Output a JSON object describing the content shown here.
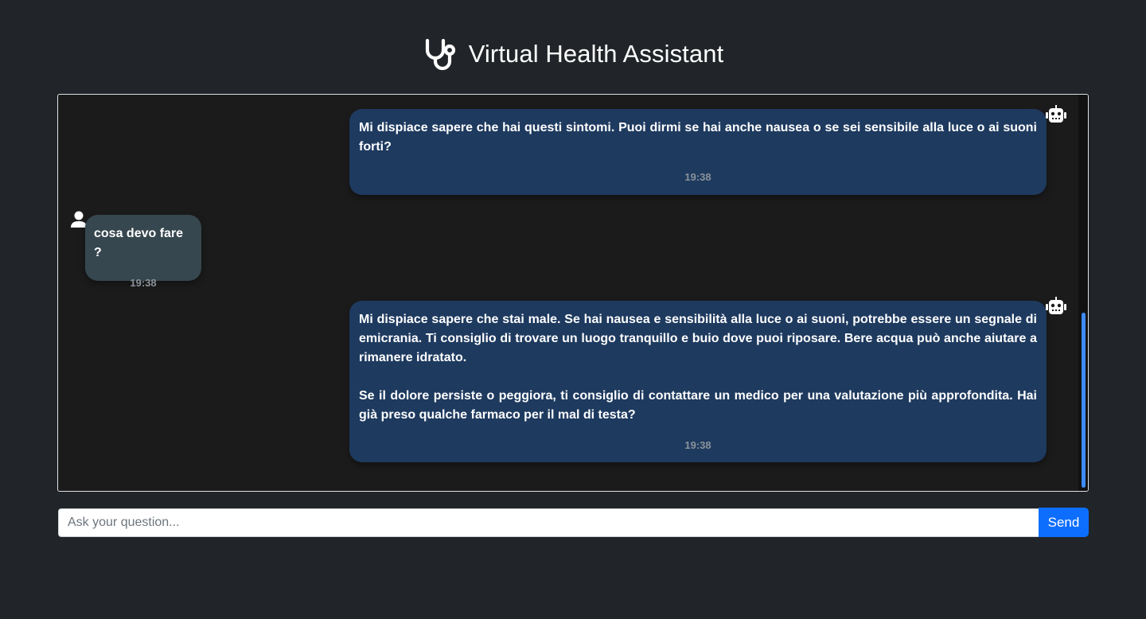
{
  "header": {
    "title": "Virtual Health Assistant",
    "icon": "stethoscope-icon"
  },
  "messages": [
    {
      "sender": "bot",
      "paragraphs": [
        "Mi dispiace sapere che hai questi sintomi. Puoi dirmi se hai anche nausea o se sei sensibile alla luce o ai suoni forti?"
      ],
      "time": "19:38",
      "avatar": "robot-icon"
    },
    {
      "sender": "user",
      "paragraphs": [
        "cosa devo fare ?"
      ],
      "time": "19:38",
      "avatar": "user-icon"
    },
    {
      "sender": "bot",
      "paragraphs": [
        "Mi dispiace sapere che stai male. Se hai nausea e sensibilità alla luce o ai suoni, potrebbe essere un segnale di emicrania. Ti consiglio di trovare un luogo tranquillo e buio dove puoi riposare. Bere acqua può anche aiutare a rimanere idratato.",
        "Se il dolore persiste o peggiora, ti consiglio di contattare un medico per una valutazione più approfondita. Hai già preso qualche farmaco per il mal di testa?"
      ],
      "time": "19:38",
      "avatar": "robot-icon"
    }
  ],
  "composer": {
    "placeholder": "Ask your question...",
    "value": "",
    "send_label": "Send"
  },
  "colors": {
    "page_bg": "#212529",
    "chat_bg": "#1b1b1b",
    "bot_bubble": "#1e3a5f",
    "user_bubble": "#37474f",
    "accent": "#0d6efd"
  }
}
